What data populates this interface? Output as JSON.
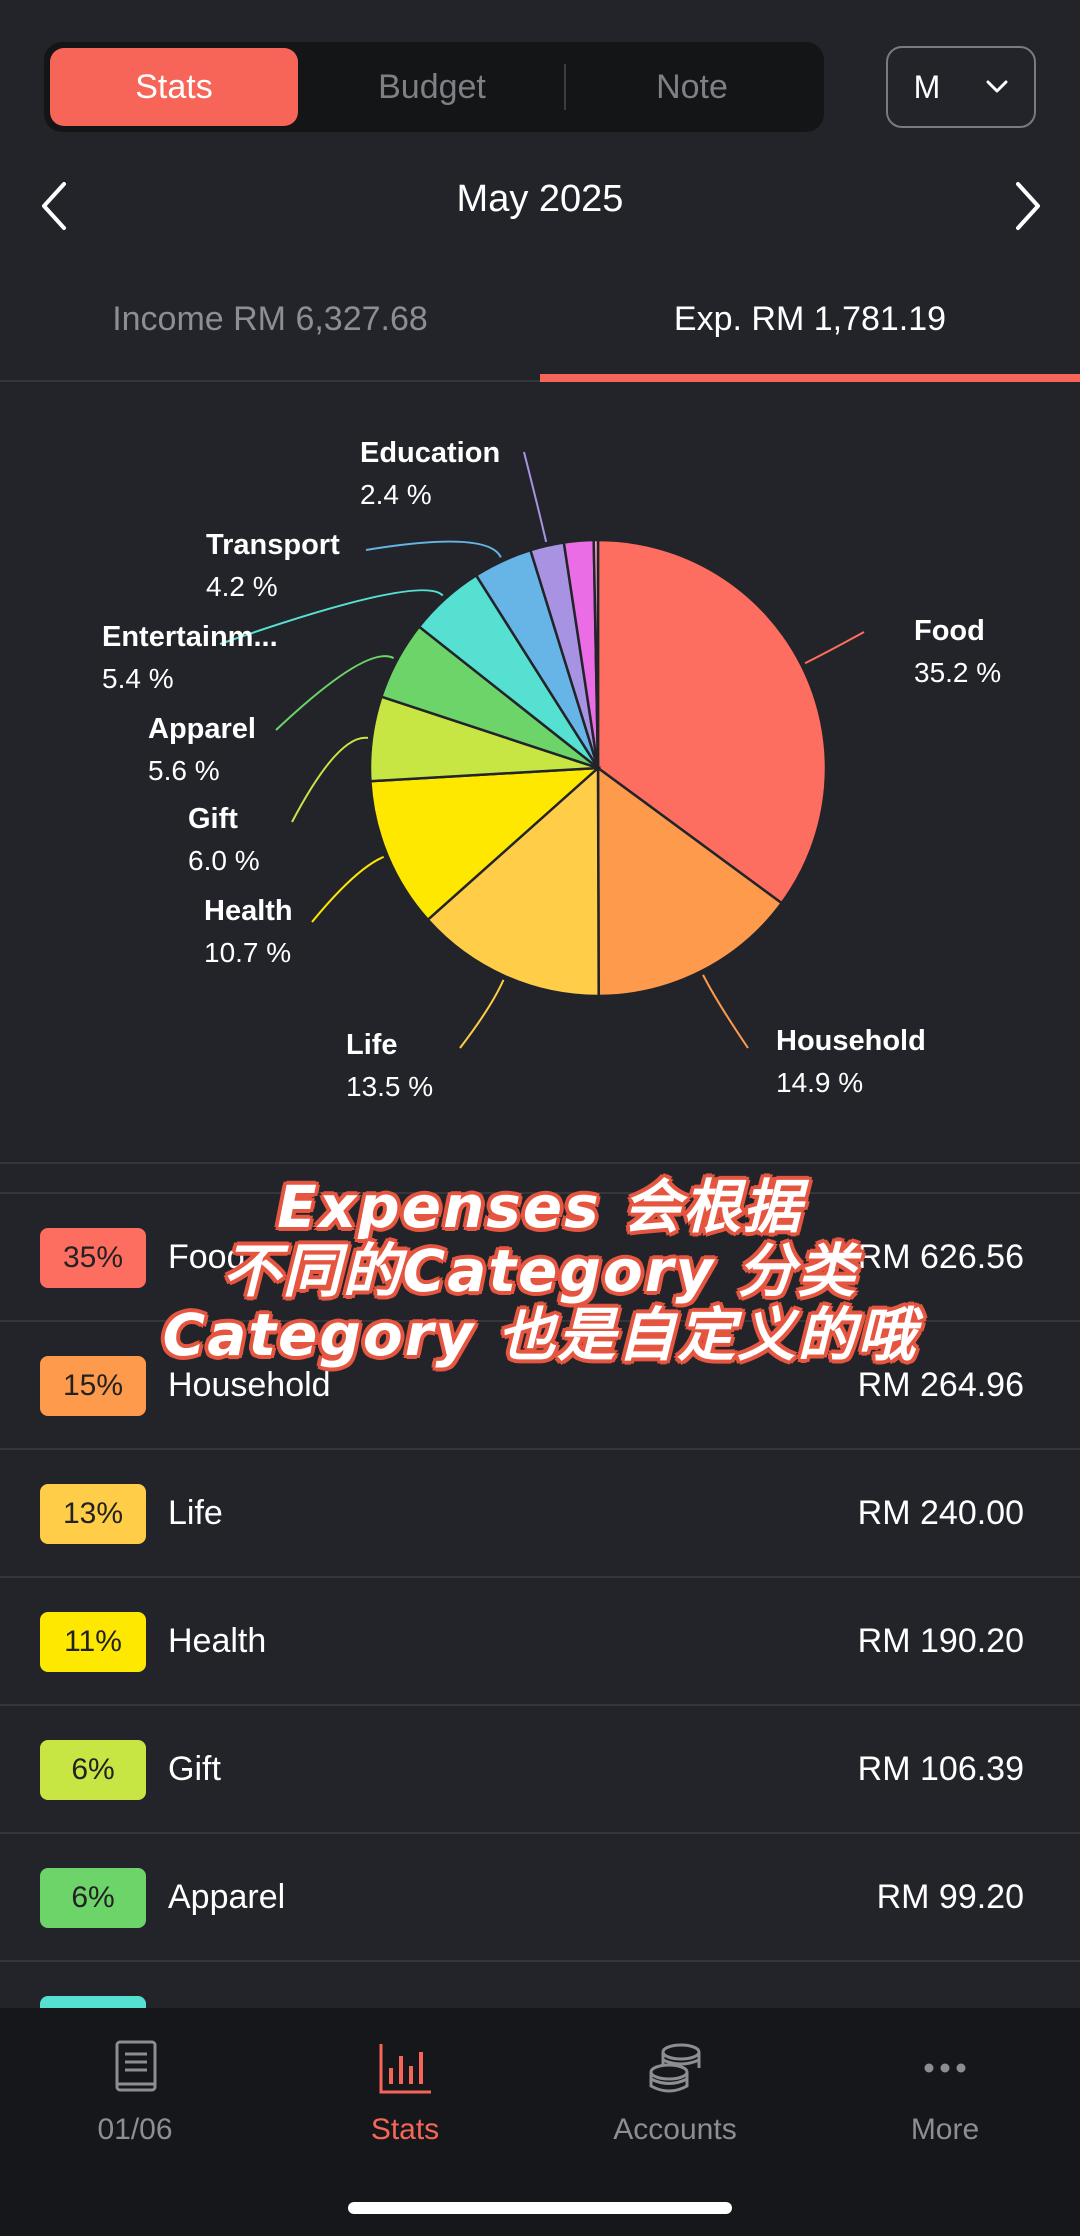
{
  "segment": {
    "tabs": [
      {
        "label": "Stats",
        "active": true
      },
      {
        "label": "Budget",
        "active": false
      },
      {
        "label": "Note",
        "active": false
      }
    ]
  },
  "period_selector": {
    "value": "M"
  },
  "month_title": "May 2025",
  "summary_tabs": {
    "income": "Income RM 6,327.68",
    "expense": "Exp. RM 1,781.19",
    "active": "expense"
  },
  "chart_data": {
    "type": "pie",
    "slices": [
      {
        "label": "Food",
        "percent_label": "35.2 %",
        "value": 35.2,
        "color": "#fd6e60"
      },
      {
        "label": "Household",
        "percent_label": "14.9 %",
        "value": 14.9,
        "color": "#fe9a4c"
      },
      {
        "label": "Life",
        "percent_label": "13.5 %",
        "value": 13.5,
        "color": "#ffcd47"
      },
      {
        "label": "Health",
        "percent_label": "10.7 %",
        "value": 10.7,
        "color": "#ffe800"
      },
      {
        "label": "Gift",
        "percent_label": "6.0 %",
        "value": 6.0,
        "color": "#c8e643"
      },
      {
        "label": "Apparel",
        "percent_label": "5.6 %",
        "value": 5.6,
        "color": "#6dd46a"
      },
      {
        "label": "Entertainm...",
        "percent_label": "5.4 %",
        "value": 5.4,
        "color": "#56e0d2"
      },
      {
        "label": "Transport",
        "percent_label": "4.2 %",
        "value": 4.2,
        "color": "#66b5e6"
      },
      {
        "label": "Education",
        "percent_label": "2.4 %",
        "value": 2.4,
        "color": "#a893e2"
      },
      {
        "label": "",
        "percent_label": "",
        "value": 2.1,
        "color": "#ea6de6"
      },
      {
        "label": "",
        "percent_label": "",
        "value": 0.3,
        "color": "#f4a3c9"
      }
    ]
  },
  "category_list": [
    {
      "badge": "35%",
      "name": "Food",
      "amount": "RM 626.56",
      "color": "#fd6e60"
    },
    {
      "badge": "15%",
      "name": "Household",
      "amount": "RM 264.96",
      "color": "#fe9a4c"
    },
    {
      "badge": "13%",
      "name": "Life",
      "amount": "RM 240.00",
      "color": "#ffcd47"
    },
    {
      "badge": "11%",
      "name": "Health",
      "amount": "RM 190.20",
      "color": "#ffe800"
    },
    {
      "badge": "6%",
      "name": "Gift",
      "amount": "RM 106.39",
      "color": "#c8e643"
    },
    {
      "badge": "6%",
      "name": "Apparel",
      "amount": "RM 99.20",
      "color": "#6dd46a"
    }
  ],
  "overlay_caption": {
    "line1": "Expenses 会根据",
    "line2": "不同的Category 分类",
    "line3": "Category 也是自定义的哦"
  },
  "bottom_nav": [
    {
      "label": "01/06",
      "icon": "book-icon",
      "active": false
    },
    {
      "label": "Stats",
      "icon": "bar-chart-icon",
      "active": true
    },
    {
      "label": "Accounts",
      "icon": "coins-icon",
      "active": false
    },
    {
      "label": "More",
      "icon": "more-dots-icon",
      "active": false
    }
  ],
  "colors": {
    "accent": "#f76559",
    "background": "#222429"
  }
}
